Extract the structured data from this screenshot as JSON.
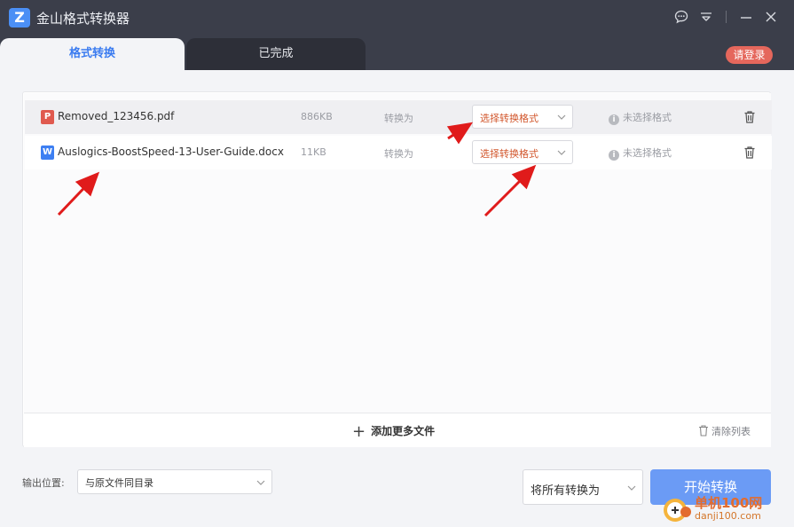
{
  "app": {
    "logo_letter": "Z",
    "title": "金山格式转换器"
  },
  "window_controls": [
    "chat-icon",
    "menu-icon",
    "minimize-icon",
    "close-icon"
  ],
  "tabs": [
    {
      "label": "格式转换",
      "active": true
    },
    {
      "label": "已完成",
      "active": false
    }
  ],
  "login_label": "请登录",
  "files": [
    {
      "type": "pdf",
      "icon_glyph": "P",
      "name": "Removed_123456.pdf",
      "size": "886KB",
      "convert_label": "转换为",
      "format_placeholder": "选择转换格式",
      "status": "未选择格式"
    },
    {
      "type": "word",
      "icon_glyph": "W",
      "name": "Auslogics-BoostSpeed-13-User-Guide.docx",
      "size": "11KB",
      "convert_label": "转换为",
      "format_placeholder": "选择转换格式",
      "status": "未选择格式"
    }
  ],
  "info_glyph": "i",
  "add_files_glyph": "+",
  "add_files_label": "添加更多文件",
  "clear_list_label": "清除列表",
  "output": {
    "label": "输出位置:",
    "value": "与原文件同目录"
  },
  "convert_all": {
    "value": "将所有转换为"
  },
  "start_label": "开始转换",
  "watermark": {
    "text": "单机100网",
    "sub": "danji100.com"
  },
  "colors": {
    "titlebar": "#3b3e4a",
    "accent": "#3a7bf0",
    "login": "#e5675c",
    "start": "#6b9bf5",
    "warning_text": "#d2572d",
    "arrow": "#e01b1b"
  }
}
